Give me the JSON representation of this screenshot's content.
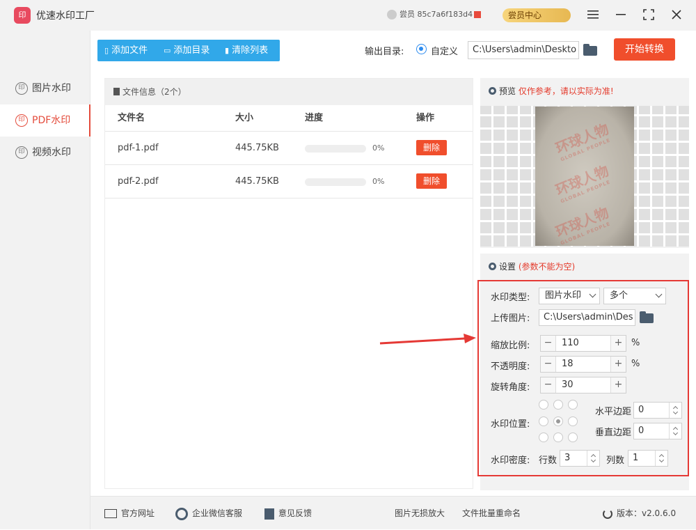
{
  "app": {
    "title": "优速水印工厂",
    "logo_text": "印",
    "account": "尝员 85c7a6f183d4",
    "member_button": "尝员中心",
    "icons": {
      "menu": "menu-icon",
      "minimize": "minimize-icon",
      "maximize": "maximize-icon",
      "close": "close-icon"
    }
  },
  "sidebar": {
    "items": [
      {
        "label": "图片水印",
        "icon": "印",
        "active": false
      },
      {
        "label": "PDF水印",
        "icon": "印",
        "active": true
      },
      {
        "label": "视频水印",
        "icon": "印",
        "active": false
      }
    ]
  },
  "toolbar": {
    "add_file": "添加文件",
    "add_dir": "添加目录",
    "clear_list": "清除列表"
  },
  "output": {
    "label": "输出目录:",
    "mode": "自定义",
    "path": "C:\\Users\\admin\\Deskto",
    "start_button": "开始转换"
  },
  "files": {
    "header": "文件信息（2个）",
    "columns": [
      "文件名",
      "大小",
      "进度",
      "操作"
    ],
    "rows": [
      {
        "name": "pdf-1.pdf",
        "size": "445.75KB",
        "progress": "0%",
        "progress_value": 0,
        "action": "删除"
      },
      {
        "name": "pdf-2.pdf",
        "size": "445.75KB",
        "progress": "0%",
        "progress_value": 0,
        "action": "删除"
      }
    ]
  },
  "preview": {
    "title": "预览",
    "note": "仅作参考，请以实际为准!",
    "watermark_text": "环球人物",
    "watermark_sub": "GLOBAL PEOPLE"
  },
  "settings": {
    "title": "设置",
    "note": "(参数不能为空)",
    "type_label": "水印类型:",
    "type_value": "图片水印",
    "count_value": "多个",
    "upload_label": "上传图片:",
    "upload_path": "C:\\Users\\admin\\Des",
    "scale_label": "缩放比例:",
    "scale_value": "110",
    "scale_unit": "%",
    "opacity_label": "不透明度:",
    "opacity_value": "18",
    "opacity_unit": "%",
    "rotation_label": "旋转角度:",
    "rotation_value": "30",
    "position_label": "水印位置:",
    "h_margin_label": "水平边距",
    "h_margin_value": "0",
    "v_margin_label": "垂直边距",
    "v_margin_value": "0",
    "density_label": "水印密度:",
    "rows_label": "行数",
    "rows_value": "3",
    "cols_label": "列数",
    "cols_value": "1",
    "minus": "−",
    "plus": "+"
  },
  "footer": {
    "website": "官方网址",
    "wechat": "企业微信客服",
    "feedback": "意见反馈",
    "enlarge": "图片无损放大",
    "rename": "文件批量重命名",
    "version": "版本：v2.0.6.0"
  },
  "colors": {
    "accent": "#31a8e9",
    "danger": "#f04e2c",
    "highlight_box": "#e53935"
  }
}
